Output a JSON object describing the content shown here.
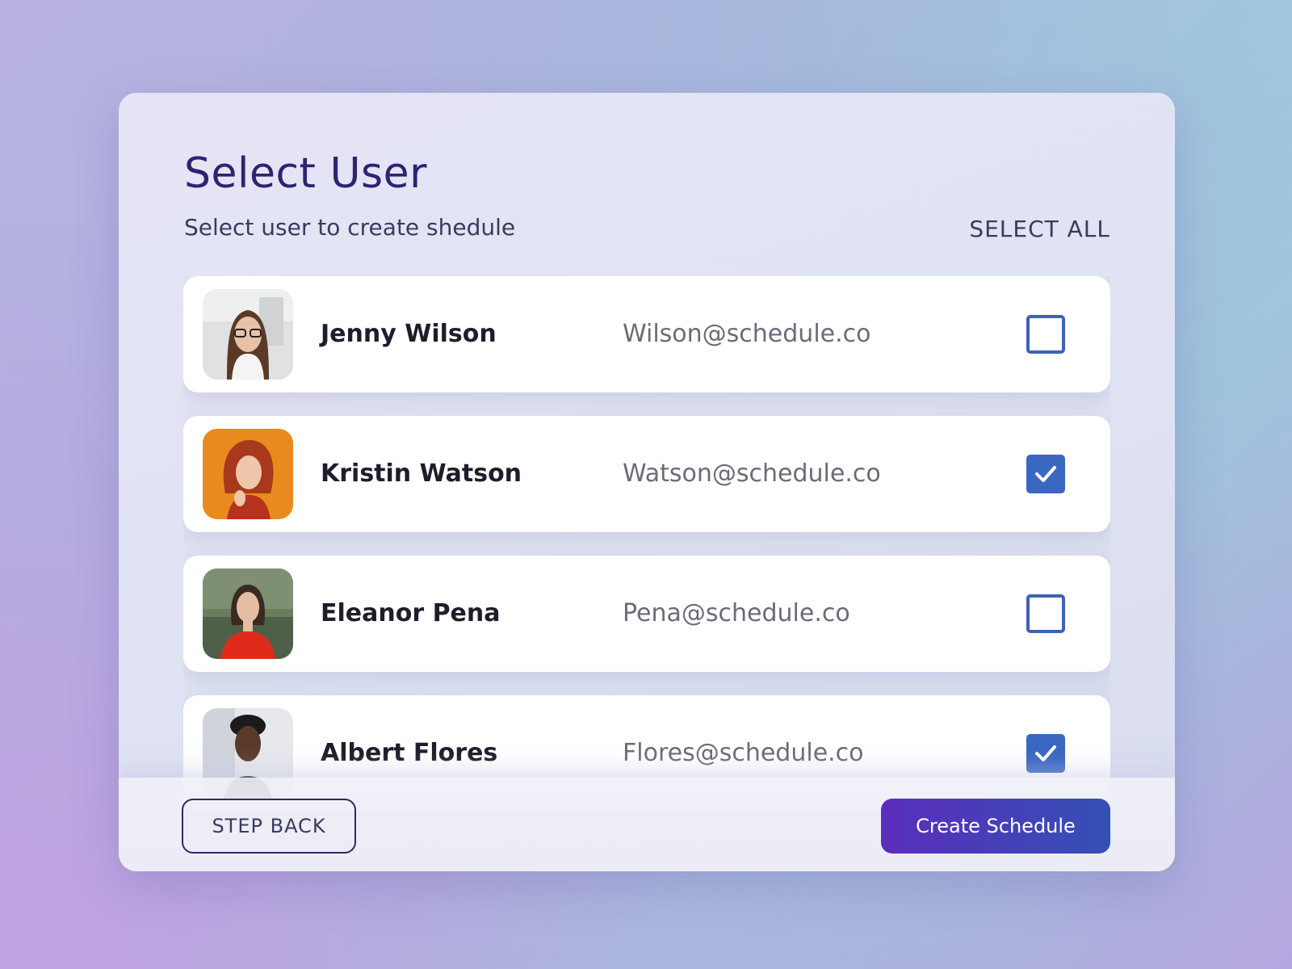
{
  "header": {
    "title": "Select User",
    "subtitle": "Select user to create shedule",
    "select_all_label": "SELECT ALL"
  },
  "users": [
    {
      "name": "Jenny Wilson",
      "email": "Wilson@schedule.co",
      "checked": false
    },
    {
      "name": "Kristin Watson",
      "email": "Watson@schedule.co",
      "checked": true
    },
    {
      "name": "Eleanor Pena",
      "email": "Pena@schedule.co",
      "checked": false
    },
    {
      "name": "Albert Flores",
      "email": "Flores@schedule.co",
      "checked": true
    }
  ],
  "footer": {
    "back_label": "STEP BACK",
    "create_label": "Create Schedule"
  },
  "colors": {
    "accent": "#3a67c2",
    "title": "#2e2370",
    "button_gradient_start": "#5a2dbb",
    "button_gradient_end": "#3450b5"
  }
}
